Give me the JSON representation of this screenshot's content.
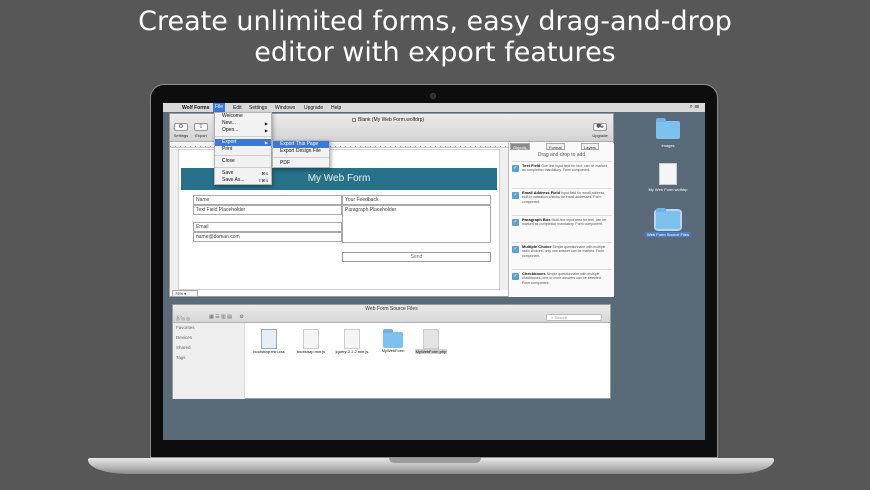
{
  "headline": {
    "line1": "Create unlimited forms, easy drag-and-drop",
    "line2": "editor with export features"
  },
  "menubar": {
    "apple_icon": "apple-icon",
    "app_name": "Wolf Forms",
    "items": [
      "File",
      "Edit",
      "Settings",
      "Windows",
      "Upgrade",
      "Help"
    ],
    "active_item": "File"
  },
  "window": {
    "title": "Blank (My Web Form.wolfdrp)",
    "toolbar": {
      "settings_label": "Settings",
      "export_label": "Export",
      "upgrade_label": "Upgrade"
    },
    "zoom": "75%"
  },
  "file_menu": {
    "items": [
      {
        "label": "Welcome",
        "shortcut": ""
      },
      {
        "label": "New...",
        "shortcut": "▶"
      },
      {
        "label": "Open...",
        "shortcut": "▶"
      },
      {
        "label": "Export",
        "shortcut": "▶"
      },
      {
        "label": "Print",
        "shortcut": ""
      },
      {
        "label": "Close",
        "shortcut": ""
      },
      {
        "label": "Save",
        "shortcut": "⌘S"
      },
      {
        "label": "Save As...",
        "shortcut": "⇧⌘S"
      }
    ]
  },
  "export_submenu": {
    "items": [
      "Export This Page",
      "Export Design File",
      "PDF"
    ]
  },
  "form": {
    "banner_title": "My Web Form",
    "name_label": "Name",
    "name_placeholder": "Text Field Placeholder",
    "email_label": "Email",
    "email_placeholder": "name@doman.com",
    "feedback_label": "Your Feedback",
    "feedback_placeholder": "Paragraph Placeholder",
    "send_button": "Send"
  },
  "panel": {
    "tabs": [
      "Objects",
      "Format",
      "Layers"
    ],
    "active_tab": "Objects",
    "drag_tip": "Drag and drop to add",
    "items": [
      {
        "name": "Text Field",
        "desc": "One line input field for text, can be marked as completion mandatory. Form component."
      },
      {
        "name": "Email Address Field",
        "desc": "Input field for email address, built in validation checks for email addresses. Form component."
      },
      {
        "name": "Paragraph Box",
        "desc": "Multi-line input area for text, can be marked as completion mandatory. Form component."
      },
      {
        "name": "Multiple Choice",
        "desc": "Simple questionnaire with multiple radio choices, only one answer can be marked. Form component."
      },
      {
        "name": "Checkboxes",
        "desc": "Simple questionnaire with multiple checkboxes, one or more answers can be selected. Form component."
      }
    ]
  },
  "desktop": {
    "icons": [
      {
        "label": "Images",
        "kind": "folder"
      },
      {
        "label": "My Web Form.wolfdrp",
        "kind": "file"
      },
      {
        "label": "Web Form Source Files",
        "kind": "folder",
        "selected": true
      }
    ]
  },
  "finder": {
    "title": "Web Form Source Files",
    "search_placeholder": "Search",
    "sidebar": [
      "Favorites",
      "Devices",
      "Shared",
      "Tags"
    ],
    "files": [
      {
        "name": "bootstrap.min.css",
        "kind": "file"
      },
      {
        "name": "bootstrap.min.js",
        "kind": "file"
      },
      {
        "name": "jquery-2.2.2.min.js",
        "kind": "file"
      },
      {
        "name": "MyWebForm",
        "kind": "folder"
      },
      {
        "name": "MyWebForm.php",
        "kind": "file",
        "selected": true
      }
    ]
  },
  "colors": {
    "background": "#575757",
    "banner": "#27728a",
    "menu_highlight": "#3b79d6",
    "folder": "#7dc1ef"
  }
}
